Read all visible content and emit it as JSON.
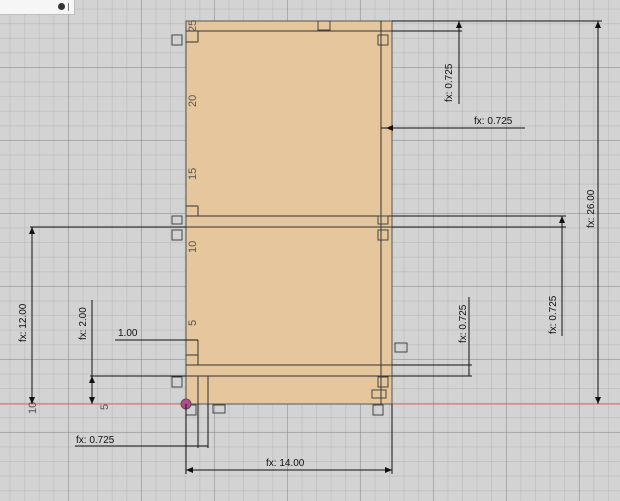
{
  "canvas": {
    "origin_marker": "origin-point",
    "axis_color": "#d06a6a"
  },
  "panel": {
    "fill": "#e6c79d",
    "stroke": "#555555"
  },
  "axis_labels": {
    "y_25": "25",
    "y_20": "20",
    "y_15": "15",
    "y_10": "10",
    "y_5": "5",
    "y_left_10": "10",
    "y_left_5": "5"
  },
  "dimensions": {
    "top_slot": "fx: 0.725",
    "right_slot": "fx: 0.725",
    "total_height": "fx: 26.00",
    "mid_height": "fx: 0.725",
    "bottom_slot": "fx: 0.725",
    "left_height": "fx: 12.00",
    "left_small": "fx: 2.00",
    "offset_label": "1.00",
    "bottom_left": "fx: 0.725",
    "width": "fx: 14.00"
  }
}
